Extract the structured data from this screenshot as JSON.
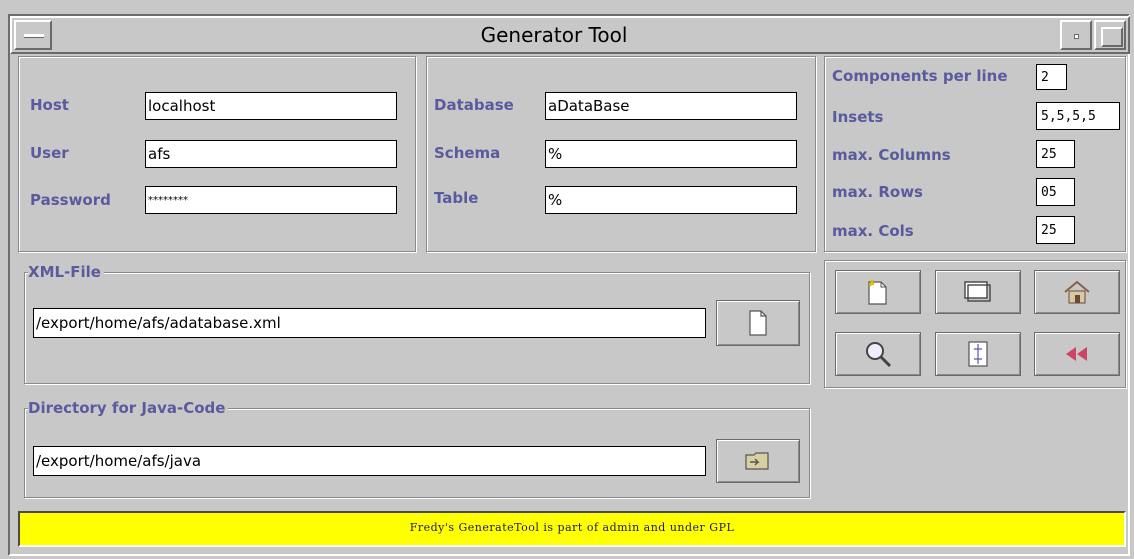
{
  "window": {
    "title": "Generator Tool"
  },
  "connection": {
    "host_label": "Host",
    "host_value": "localhost",
    "user_label": "User",
    "user_value": "afs",
    "password_label": "Password",
    "password_value": "********"
  },
  "database": {
    "database_label": "Database",
    "database_value": "aDataBase",
    "schema_label": "Schema",
    "schema_value": "%",
    "table_label": "Table",
    "table_value": "%"
  },
  "layout_options": {
    "components_label": "Components per line",
    "components_value": "2",
    "insets_label": "Insets",
    "insets_value": "5,5,5,5",
    "max_columns_label": "max. Columns",
    "max_columns_value": "25",
    "max_rows_label": "max. Rows",
    "max_rows_value": "05",
    "max_cols_label": "max. Cols",
    "max_cols_value": "25"
  },
  "xml_file": {
    "legend": "XML-File",
    "path": "/export/home/afs/adatabase.xml",
    "browse_icon": "file-icon"
  },
  "java_dir": {
    "legend": "Directory for Java-Code",
    "path": "/export/home/afs/java",
    "browse_icon": "folder-icon"
  },
  "toolbar": {
    "buttons": [
      {
        "icon": "new-file-icon"
      },
      {
        "icon": "window-icon"
      },
      {
        "icon": "home-icon"
      },
      {
        "icon": "search-icon"
      },
      {
        "icon": "document-split-icon"
      },
      {
        "icon": "rewind-icon"
      }
    ]
  },
  "status": {
    "text": "Fredy's GenerateTool is part of admin and under GPL",
    "background": "#ffff00"
  },
  "colors": {
    "label": "#5a5a9e",
    "window_bg": "#c8c8c8"
  }
}
